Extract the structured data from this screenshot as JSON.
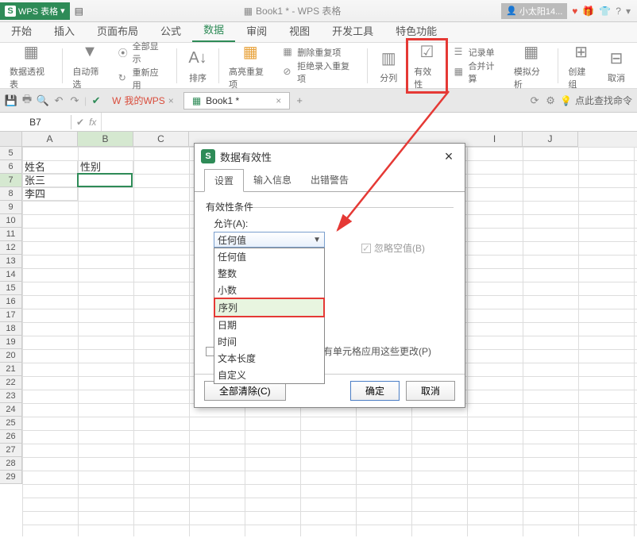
{
  "app": {
    "name": "WPS 表格",
    "doc_title": "Book1 * - WPS 表格",
    "user": "小太阳14..."
  },
  "menus": [
    "开始",
    "插入",
    "页面布局",
    "公式",
    "数据",
    "审阅",
    "视图",
    "开发工具",
    "特色功能"
  ],
  "menu_active": 4,
  "ribbon": {
    "pivot": "数据透视表",
    "autofilter": "自动筛选",
    "show_all": "全部显示",
    "reapply": "重新应用",
    "sort": "排序",
    "highlight_dup": "高亮重复项",
    "rm_dup": "删除重复项",
    "reject_dup": "拒绝录入重复项",
    "text_cols": "分列",
    "validity": "有效性",
    "record": "记录单",
    "consolidate": "合并计算",
    "whatif": "模拟分析",
    "group": "创建组",
    "ungroup": "取消"
  },
  "tabs": {
    "wps": "我的WPS",
    "book": "Book1 *",
    "find_cmd": "点此查找命令"
  },
  "name_box": "B7",
  "columns": [
    "A",
    "B",
    "C",
    "I",
    "J"
  ],
  "rows": [
    5,
    6,
    7,
    8,
    9,
    10,
    11,
    12,
    13,
    14,
    15,
    16,
    17,
    18,
    19,
    20,
    21,
    22,
    23,
    24,
    25,
    26,
    27,
    28,
    29
  ],
  "cells": {
    "A6": "姓名",
    "B6": "性别",
    "A7": "张三",
    "A8": "李四"
  },
  "dialog": {
    "title": "数据有效性",
    "tabs": [
      "设置",
      "输入信息",
      "出错警告"
    ],
    "tab_active": 0,
    "group_label": "有效性条件",
    "allow_label": "允许(A):",
    "combo_value": "任何值",
    "combo_items": [
      "任何值",
      "整数",
      "小数",
      "序列",
      "日期",
      "时间",
      "文本长度",
      "自定义"
    ],
    "highlight_index": 3,
    "ignore_blank": "忽略空值(B)",
    "apply_all": "对所有同样设置的其他所有单元格应用这些更改(P)",
    "clear_all": "全部清除(C)",
    "ok": "确定",
    "cancel": "取消"
  }
}
